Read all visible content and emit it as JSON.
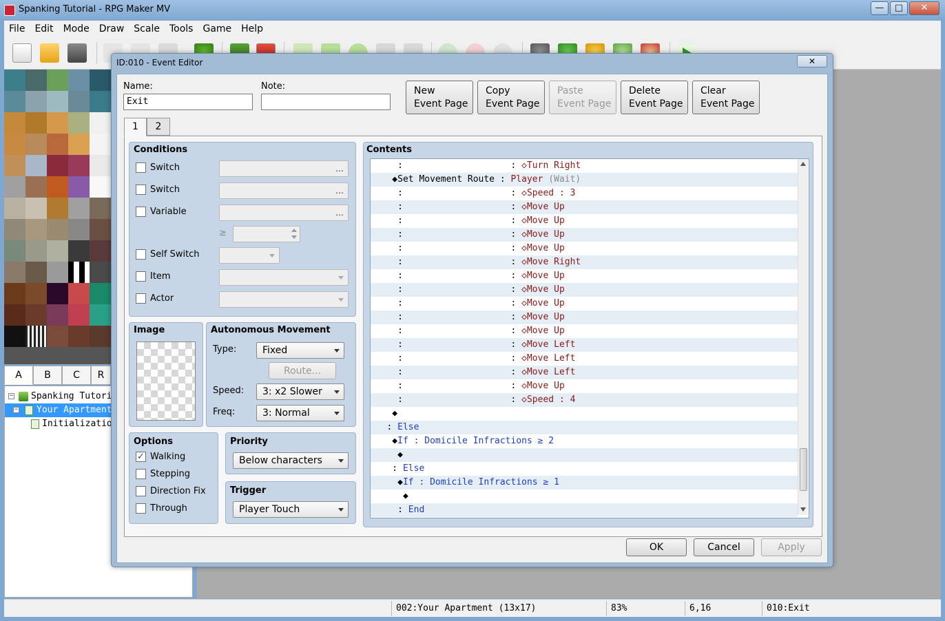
{
  "window": {
    "title": "Spanking Tutorial - RPG Maker MV",
    "controls": [
      "—",
      "□",
      "✕"
    ]
  },
  "menu": [
    "File",
    "Edit",
    "Mode",
    "Draw",
    "Scale",
    "Tools",
    "Game",
    "Help"
  ],
  "toolbar": [
    "new-project-icon",
    "open-project-icon",
    "save-project-icon",
    "cut-icon",
    "copy-icon",
    "paste-icon",
    "undo-icon",
    "map-mode-icon",
    "event-mode-icon",
    "pencil-icon",
    "rectangle-icon",
    "ellipse-icon",
    "fill-icon",
    "shadow-pen-icon",
    "zoom-in-icon",
    "zoom-out-icon",
    "actual-size-icon",
    "database-icon",
    "plugin-manager-icon",
    "sound-test-icon",
    "event-searcher-icon",
    "character-generator-icon",
    "playtest-icon"
  ],
  "tileset_tabs": [
    "A",
    "B",
    "C",
    "R"
  ],
  "map_tree": [
    {
      "label": "Spanking Tutorial",
      "toggle": "−"
    },
    {
      "label": "Your Apartment",
      "toggle": "−",
      "selected": true
    },
    {
      "label": "Initialization"
    }
  ],
  "status": {
    "map": "002:Your Apartment (13x17)",
    "zoom": "83%",
    "coords": "6,16",
    "event": "010:Exit"
  },
  "dialog": {
    "title": "ID:010 - Event Editor",
    "close": "✕",
    "name_label": "Name:",
    "name_value": "Exit",
    "note_label": "Note:",
    "note_value": "",
    "page_buttons": [
      {
        "line1": "New",
        "line2": "Event Page",
        "enabled": true
      },
      {
        "line1": "Copy",
        "line2": "Event Page",
        "enabled": true
      },
      {
        "line1": "Paste",
        "line2": "Event Page",
        "enabled": false
      },
      {
        "line1": "Delete",
        "line2": "Event Page",
        "enabled": true
      },
      {
        "line1": "Clear",
        "line2": "Event Page",
        "enabled": true
      }
    ],
    "page_tabs": [
      "1",
      "2"
    ],
    "conditions": {
      "title": "Conditions",
      "items": [
        {
          "label": "Switch",
          "checked": false
        },
        {
          "label": "Switch",
          "checked": false
        },
        {
          "label": "Variable",
          "checked": false
        },
        {
          "label": "Self Switch",
          "checked": false
        },
        {
          "label": "Item",
          "checked": false
        },
        {
          "label": "Actor",
          "checked": false
        }
      ],
      "compare": "≥",
      "dots": "…"
    },
    "image": {
      "title": "Image"
    },
    "autonomous": {
      "title": "Autonomous Movement",
      "type_label": "Type:",
      "type_value": "Fixed",
      "route_label": "Route...",
      "speed_label": "Speed:",
      "speed_value": "3: x2 Slower",
      "freq_label": "Freq:",
      "freq_value": "3: Normal"
    },
    "options": {
      "title": "Options",
      "items": [
        {
          "label": "Walking",
          "checked": true
        },
        {
          "label": "Stepping",
          "checked": false
        },
        {
          "label": "Direction Fix",
          "checked": false
        },
        {
          "label": "Through",
          "checked": false
        }
      ]
    },
    "priority": {
      "title": "Priority",
      "value": "Below characters"
    },
    "trigger": {
      "title": "Trigger",
      "value": "Player Touch"
    },
    "contents": {
      "title": "Contents",
      "rows": [
        {
          "pre": "     :                    : ",
          "text": "◇Turn Right",
          "cls": "c-red"
        },
        {
          "pre": "    ◆Set Movement Route : ",
          "text": "Player",
          "cls": "c-red",
          "extra": " (Wait)"
        },
        {
          "pre": "     :                    : ",
          "text": "◇Speed : 3",
          "cls": "c-red"
        },
        {
          "pre": "     :                    : ",
          "text": "◇Move Up",
          "cls": "c-red"
        },
        {
          "pre": "     :                    : ",
          "text": "◇Move Up",
          "cls": "c-red"
        },
        {
          "pre": "     :                    : ",
          "text": "◇Move Up",
          "cls": "c-red"
        },
        {
          "pre": "     :                    : ",
          "text": "◇Move Up",
          "cls": "c-red"
        },
        {
          "pre": "     :                    : ",
          "text": "◇Move Right",
          "cls": "c-red"
        },
        {
          "pre": "     :                    : ",
          "text": "◇Move Up",
          "cls": "c-red"
        },
        {
          "pre": "     :                    : ",
          "text": "◇Move Up",
          "cls": "c-red"
        },
        {
          "pre": "     :                    : ",
          "text": "◇Move Up",
          "cls": "c-red"
        },
        {
          "pre": "     :                    : ",
          "text": "◇Move Up",
          "cls": "c-red"
        },
        {
          "pre": "     :                    : ",
          "text": "◇Move Up",
          "cls": "c-red"
        },
        {
          "pre": "     :                    : ",
          "text": "◇Move Left",
          "cls": "c-red"
        },
        {
          "pre": "     :                    : ",
          "text": "◇Move Left",
          "cls": "c-red"
        },
        {
          "pre": "     :                    : ",
          "text": "◇Move Left",
          "cls": "c-red"
        },
        {
          "pre": "     :                    : ",
          "text": "◇Move Up",
          "cls": "c-red"
        },
        {
          "pre": "     :                    : ",
          "text": "◇Speed : 4",
          "cls": "c-red"
        },
        {
          "pre": "    ◆",
          "text": "",
          "cls": ""
        },
        {
          "pre": "   : ",
          "text": "Else",
          "cls": "c-blue"
        },
        {
          "pre": "    ◆",
          "text": "If : Domicile Infractions ≥ 2",
          "cls": "c-blue"
        },
        {
          "pre": "     ◆",
          "text": "",
          "cls": ""
        },
        {
          "pre": "    : ",
          "text": "Else",
          "cls": "c-blue"
        },
        {
          "pre": "     ◆",
          "text": "If : Domicile Infractions ≥ 1",
          "cls": "c-blue"
        },
        {
          "pre": "      ◆",
          "text": "",
          "cls": ""
        },
        {
          "pre": "     : ",
          "text": "End",
          "cls": "c-blue"
        }
      ]
    },
    "ok": "OK",
    "cancel": "Cancel",
    "apply": "Apply"
  }
}
